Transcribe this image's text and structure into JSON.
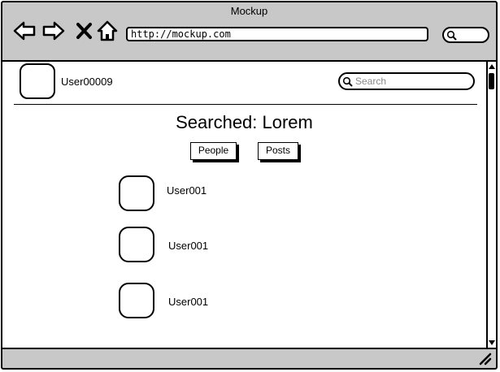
{
  "window": {
    "title": "Mockup"
  },
  "browser": {
    "url": "http://mockup.com"
  },
  "header": {
    "username": "User00009",
    "search_placeholder": "Search"
  },
  "main": {
    "heading": "Searched: Lorem",
    "tabs": [
      {
        "label": "People"
      },
      {
        "label": "Posts"
      }
    ],
    "results": [
      {
        "name": "User001"
      },
      {
        "name": "User001"
      },
      {
        "name": "User001"
      }
    ]
  }
}
